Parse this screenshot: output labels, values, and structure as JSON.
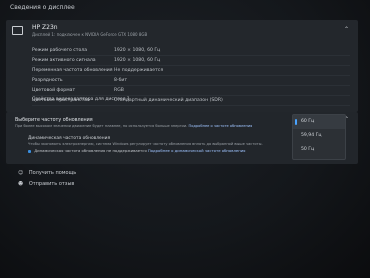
{
  "page": {
    "title": "Сведения о дисплее"
  },
  "display": {
    "name": "HP Z23n",
    "subtitle": "Дисплей 1: подключен к NVIDIA GeForce GTX 1080 8GB",
    "properties": [
      {
        "name": "Режим рабочего стола",
        "value": "1920 × 1080, 60 Гц"
      },
      {
        "name": "Режим активного сигнала",
        "value": "1920 × 1080, 60 Гц"
      },
      {
        "name": "Переменная частота обновления",
        "value": "Не поддерживается"
      },
      {
        "name": "Разрядность",
        "value": "8-бит"
      },
      {
        "name": "Цветовой формат",
        "value": "RGB"
      },
      {
        "name": "Цветовое пространство",
        "value": "Стандартный динамический диапазон (SDR)"
      }
    ],
    "adapter_link": "Свойства видеоадаптера для дисплея 1"
  },
  "refresh": {
    "title": "Выберите частоту обновления",
    "desc": "При более высоком значении движение будет плавнее, но используется больше энергии.",
    "desc_link": "Подробнее о частоте обновления",
    "options": [
      "60 Гц",
      "59,94 Гц",
      "50 Гц"
    ],
    "selected_index": 0
  },
  "dynamic": {
    "title": "Динамическая частота обновления",
    "desc": "Чтобы экономить электроэнергию, система Windows регулирует частоту обновления вплоть до выбранной выше частоты.",
    "checkbox_label": "Динамическая частота обновления не поддерживается",
    "checkbox_link": "Подробнее о динамической частоте обновления"
  },
  "footer": {
    "help": "Получить помощь",
    "feedback": "Отправить отзыв"
  },
  "icons": {
    "display": "monitor-icon",
    "help": "help-icon",
    "feedback": "feedback-icon",
    "chevron": "chevron-up-icon"
  },
  "colors": {
    "accent": "#4aa3ff",
    "background": "#1c1f23"
  }
}
